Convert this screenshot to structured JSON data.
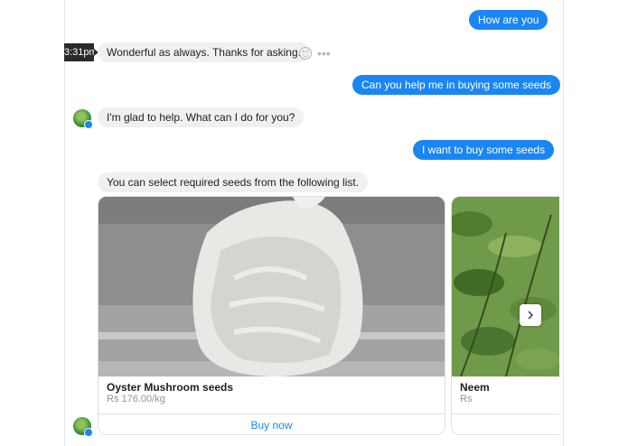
{
  "messages": [
    {
      "text": "How are you"
    },
    {
      "text": "Wonderful as always. Thanks for asking."
    },
    {
      "text": "Can you help me in buying some seeds"
    },
    {
      "text": "I'm glad to help. What can I do for you?"
    },
    {
      "text": "I want to buy some seeds"
    },
    {
      "text": "You can select required seeds from the following list."
    }
  ],
  "timestamp": "3:31pm",
  "carousel": {
    "cards": [
      {
        "title": "Oyster Mushroom seeds",
        "price": "Rs 176.00/kg",
        "button": "Buy now"
      },
      {
        "title": "Neem",
        "price": "Rs"
      }
    ]
  },
  "icons": {
    "react": "smiley-react-icon",
    "more": "more-options-icon",
    "next": "chevron-right-icon"
  },
  "colors": {
    "outgoing_bubble": "#1a86f4",
    "incoming_bubble": "#f0f0f0",
    "link": "#1a86f4"
  }
}
